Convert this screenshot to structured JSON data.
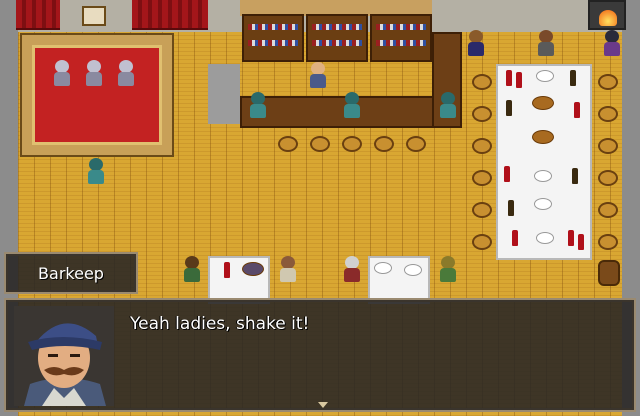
{
  "dialogue": {
    "speaker": "Barkeep",
    "message": "Yeah ladies, shake it!"
  },
  "scene": {
    "location": "tavern",
    "colors": {
      "floor": "#d9a732",
      "carpet": "#c32222",
      "curtain": "#a4161a",
      "window_bg": "#282624",
      "window_border": "#9a8a70",
      "text": "#ffffff"
    }
  },
  "icons": {
    "pause": "down-arrow-icon"
  }
}
